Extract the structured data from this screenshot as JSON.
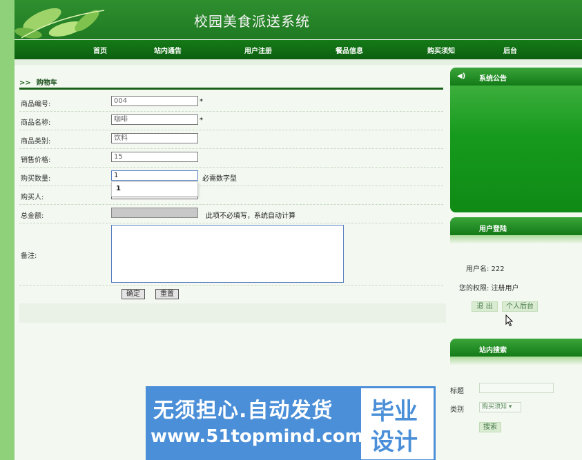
{
  "header": {
    "site_title": "校园美食派送系统"
  },
  "nav": [
    {
      "label": "首页"
    },
    {
      "label": "站内通告"
    },
    {
      "label": "用户注册"
    },
    {
      "label": "餐品信息"
    },
    {
      "label": "购买须知"
    },
    {
      "label": "后台"
    }
  ],
  "cart": {
    "title": "购物车",
    "title_icon": "double-chevron-right-icon",
    "fields": {
      "code": {
        "label": "商品编号:",
        "value": "004",
        "required": "*"
      },
      "name": {
        "label": "商品名称:",
        "value": "咖啡",
        "required": "*"
      },
      "category": {
        "label": "商品类别:",
        "value": "饮料"
      },
      "price": {
        "label": "销售价格:",
        "value": "15"
      },
      "quantity": {
        "label": "购买数量:",
        "value": "1",
        "hint": "必需数字型",
        "suggestion": "1"
      },
      "buyer": {
        "label": "购买人:",
        "value": ""
      },
      "total": {
        "label": "总金额:",
        "value": "",
        "hint": "此项不必填写，系统自动计算"
      },
      "remark": {
        "label": "备注:",
        "value": ""
      }
    },
    "confirm_label": "确定",
    "reset_label": "重置"
  },
  "sidebar": {
    "notice": {
      "title": "系统公告",
      "icon": "speaker-icon"
    },
    "login": {
      "title": "用户登陆",
      "username_text": "用户名: 222",
      "role_text": "您的权限: 注册用户",
      "logout_label": "退 出",
      "personal_label": "个人后台"
    },
    "search": {
      "title": "站内搜索",
      "title_label": "标题",
      "title_value": "",
      "category_label": "类别",
      "category_value": "购买须知",
      "search_label": "搜索"
    }
  },
  "watermark": {
    "line1": "无须担心.自动发货",
    "line2": "www.51topmind.com",
    "box_line1": "毕业",
    "box_line2": "设计"
  },
  "colors": {
    "header_green": "#1f7a22",
    "nav_green": "#0c5f10",
    "sidebar_green": "#8fd07a",
    "watermark_blue": "#4a8fd8"
  }
}
